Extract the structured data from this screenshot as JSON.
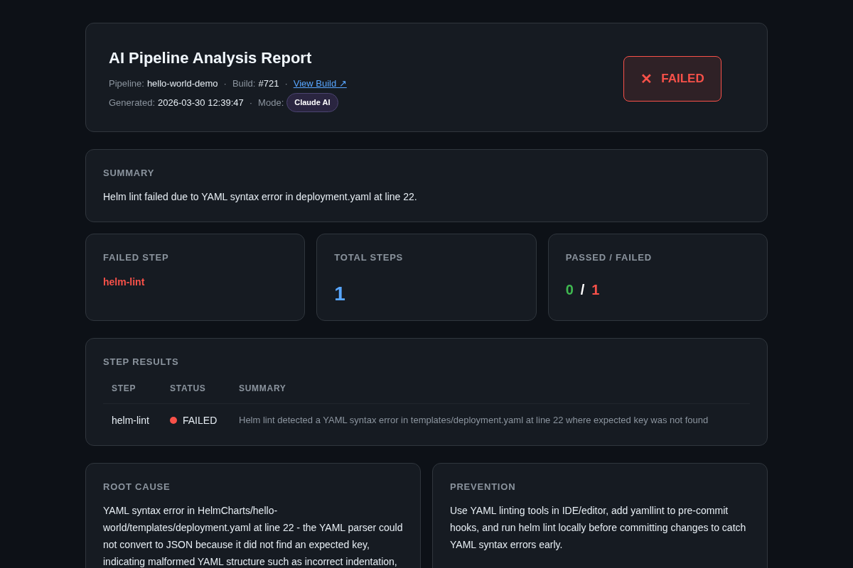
{
  "header": {
    "title": "AI Pipeline Analysis Report",
    "meta_rows": [
      {
        "items": [
          {
            "label": "Pipeline:",
            "value": "hello-world-demo",
            "kind": "text"
          },
          {
            "separator": "·",
            "label": "Build:",
            "value": "#721",
            "kind": "text"
          },
          {
            "separator": "·",
            "value": "View Build ↗",
            "kind": "link"
          }
        ]
      },
      {
        "items": [
          {
            "label": "Generated:",
            "value": "2026-03-30 12:39:47",
            "kind": "text"
          },
          {
            "separator": "·",
            "label": "Mode:",
            "value": "Claude AI",
            "kind": "badge"
          }
        ]
      }
    ],
    "status": {
      "icon": "✕",
      "label": "FAILED",
      "kind": "failed"
    }
  },
  "summary": {
    "heading": "SUMMARY",
    "text": "Helm lint failed due to YAML syntax error in deployment.yaml at line 22."
  },
  "stats": [
    {
      "heading": "FAILED STEP",
      "kind": "step",
      "value": "helm-lint"
    },
    {
      "heading": "TOTAL STEPS",
      "kind": "count",
      "value": "1"
    },
    {
      "heading": "PASSED / FAILED",
      "kind": "ratio",
      "passed": "0",
      "slash": "/",
      "failed": "1"
    }
  ],
  "step_results": {
    "heading": "STEP RESULTS",
    "columns": [
      "STEP",
      "STATUS",
      "SUMMARY"
    ],
    "rows": [
      {
        "step": "helm-lint",
        "status": "FAILED",
        "color": "#f85149",
        "summary": "Helm lint detected a YAML syntax error in templates/deployment.yaml at line 22 where expected key was not found"
      }
    ]
  },
  "details": [
    {
      "heading": "ROOT CAUSE",
      "text": "YAML syntax error in HelmCharts/hello-world/templates/deployment.yaml at line 22 - the YAML parser could not convert to JSON because it did not find an expected key, indicating malformed YAML structure such as incorrect indentation,"
    },
    {
      "heading": "PREVENTION",
      "text": "Use YAML linting tools in IDE/editor, add yamllint to pre-commit hooks, and run helm lint locally before committing changes to catch YAML syntax errors early."
    }
  ]
}
